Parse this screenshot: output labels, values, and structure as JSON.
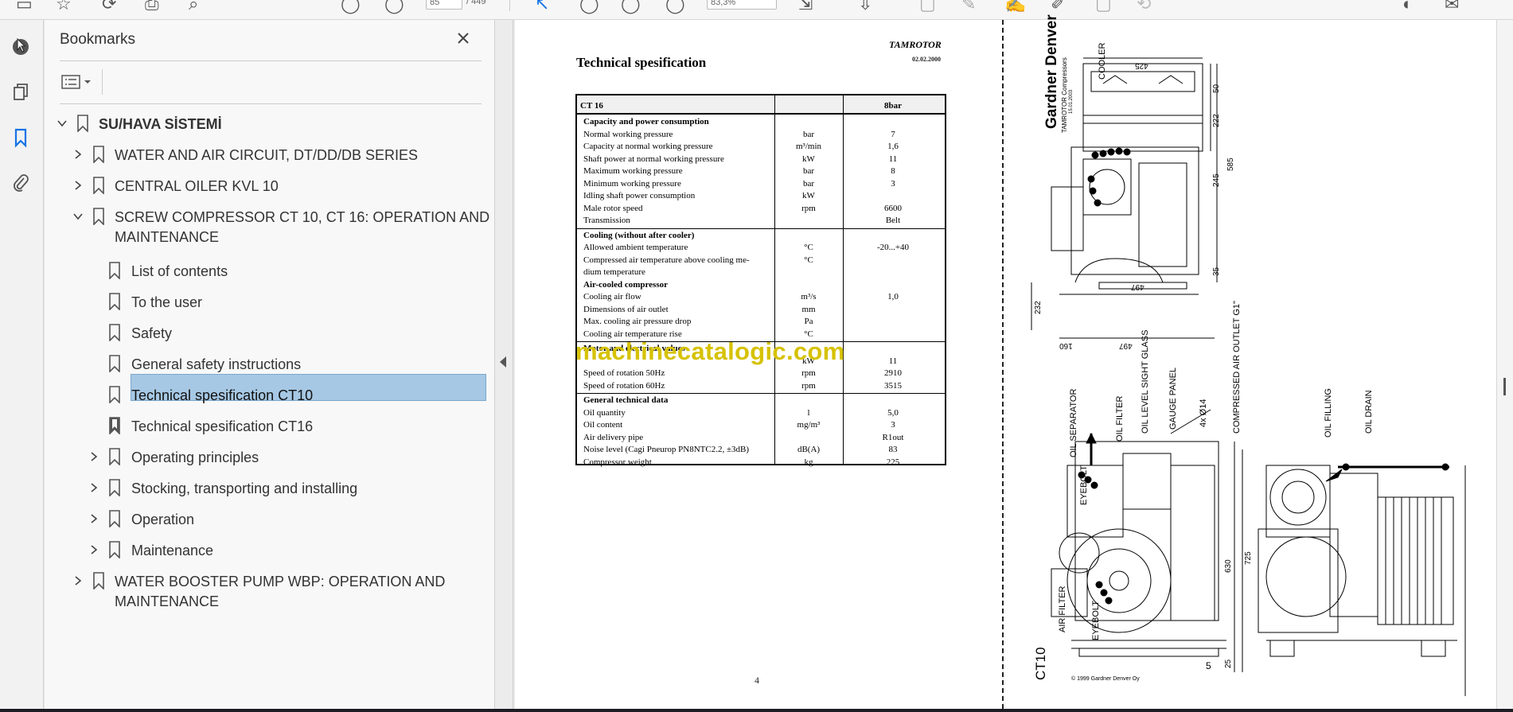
{
  "toolbar": {
    "page_current": "85",
    "page_total": "/ 449",
    "zoom": "83,3%"
  },
  "sidebar": {
    "title": "Bookmarks",
    "root": {
      "label": "SU/HAVA SİSTEMİ",
      "state": "expanded"
    },
    "items": [
      {
        "label": "WATER AND AIR CIRCUIT, DT/DD/DB SERIES",
        "state": "collapsed"
      },
      {
        "label": "CENTRAL OILER KVL 10",
        "state": "collapsed"
      },
      {
        "label_line1": "SCREW COMPRESSOR CT 10, CT 16: OPERATION AND",
        "label_line2": "MAINTENANCE",
        "state": "expanded"
      },
      {
        "label": "List of contents"
      },
      {
        "label": "To the user"
      },
      {
        "label": "Safety"
      },
      {
        "label": "General safety instructions"
      },
      {
        "label": "Technical spesification CT10",
        "selected": true
      },
      {
        "label": "Technical spesification CT16"
      },
      {
        "label": "Operating principles",
        "state": "collapsed"
      },
      {
        "label": "Stocking, transporting and installing",
        "state": "collapsed"
      },
      {
        "label": "Operation",
        "state": "collapsed"
      },
      {
        "label": "Maintenance",
        "state": "collapsed"
      },
      {
        "label_line1": "WATER BOOSTER PUMP WBP: OPERATION AND",
        "label_line2": "MAINTENANCE",
        "state": "collapsed"
      }
    ],
    "selected_color": "#a6c8e4"
  },
  "page_left": {
    "title": "Technical spesification",
    "logo": "TAMROTOR",
    "logo_date": "02.02.2000",
    "table_head": {
      "model": "CT 16",
      "unit": "",
      "value": "8bar"
    },
    "sections": [
      {
        "rows": [
          {
            "label": "Capacity and power consumption",
            "unit": "",
            "value": "",
            "section": true
          },
          {
            "label": "Normal working pressure",
            "unit": "bar",
            "value": "7"
          },
          {
            "label": "Capacity at normal working pressure",
            "unit": "m³/min",
            "value": "1,6"
          },
          {
            "label": "Shaft power at normal working pressure",
            "unit": "kW",
            "value": "11"
          },
          {
            "label": "Maximum working pressure",
            "unit": "bar",
            "value": "8"
          },
          {
            "label": "Minimum working pressure",
            "unit": "bar",
            "value": "3"
          },
          {
            "label": "Idling shaft power consumption",
            "unit": "kW",
            "value": ""
          },
          {
            "label": "Male rotor speed",
            "unit": "rpm",
            "value": "6600"
          },
          {
            "label": "Transmission",
            "unit": "",
            "value": "Belt"
          }
        ]
      },
      {
        "rows": [
          {
            "label": "Cooling (without after cooler)",
            "unit": "",
            "value": "",
            "section": true
          },
          {
            "label": "Allowed ambient temperature",
            "unit": "°C",
            "value": "-20...+40"
          },
          {
            "label": "Compressed air temperature above cooling me-",
            "unit": "°C",
            "value": ""
          },
          {
            "label": "dium temperature",
            "unit": "",
            "value": ""
          },
          {
            "label": "Air-cooled compressor",
            "unit": "",
            "value": "",
            "section": true
          },
          {
            "label": "Cooling air flow",
            "unit": "m³/s",
            "value": "1,0"
          },
          {
            "label": "Dimensions of air outlet",
            "unit": "mm",
            "value": ""
          },
          {
            "label": "Max. cooling air pressure drop",
            "unit": "Pa",
            "value": ""
          },
          {
            "label": "Cooling air temperature rise",
            "unit": "°C",
            "value": ""
          }
        ]
      },
      {
        "rows": [
          {
            "label": "Motor and electrical values",
            "unit": "",
            "value": "",
            "section": true
          },
          {
            "label": "",
            "unit": "kW",
            "value": "11"
          },
          {
            "label": "Speed of rotation          50Hz",
            "unit": "rpm",
            "value": "2910"
          },
          {
            "label": "Speed of rotation          60Hz",
            "unit": "rpm",
            "value": "3515"
          }
        ]
      },
      {
        "rows": [
          {
            "label": "General technical data",
            "unit": "",
            "value": "",
            "section": true
          },
          {
            "label": "Oil quantity",
            "unit": "l",
            "value": "5,0"
          },
          {
            "label": "Oil content",
            "unit": "mg/m³",
            "value": "3"
          },
          {
            "label": "Air delivery pipe",
            "unit": "",
            "value": "R1out"
          },
          {
            "label": "Noise level (Cagi Pneurop PN8NTC2.2, ±3dB)",
            "unit": "dB(A)",
            "value": "83"
          },
          {
            "label": "Compressor weight",
            "unit": "kg",
            "value": "225"
          }
        ]
      }
    ],
    "page_number": "4"
  },
  "watermark": "machinecatalogic.com",
  "page_right": {
    "brand": "Gardner Denver",
    "brand_sub": "TAMROTOR Compressors",
    "brand_date": "15.01.2003",
    "model": "CT10",
    "page_number": "5",
    "copyright": "© 1999 Gardner Denver Oy",
    "labels": {
      "cooler": "COOLER",
      "oil_separator": "OIL SEPARATOR",
      "oil_filter": "OIL FILTER",
      "oil_level": "OIL LEVEL SIGHT GLASS",
      "gauge_panel": "GAUGE PANEL",
      "bolt": "4x Ø14",
      "air_outlet": "COMPRESSED AIR OUTLET G1\"",
      "oil_filling": "OIL FILLING",
      "oil_drain": "OIL DRAIN",
      "eyebolt_top": "EYEBOLT",
      "eyebolt_bottom": "EYEBOLT",
      "air_filter": "AIR FILTER"
    },
    "dims": {
      "d425": "425",
      "d50": "50",
      "d222": "222",
      "d245": "245",
      "d585": "585",
      "d35": "35",
      "d497a": "497",
      "d232": "232",
      "d160": "160",
      "d497b": "497",
      "d630": "630",
      "d725": "725",
      "d25": "25"
    }
  }
}
